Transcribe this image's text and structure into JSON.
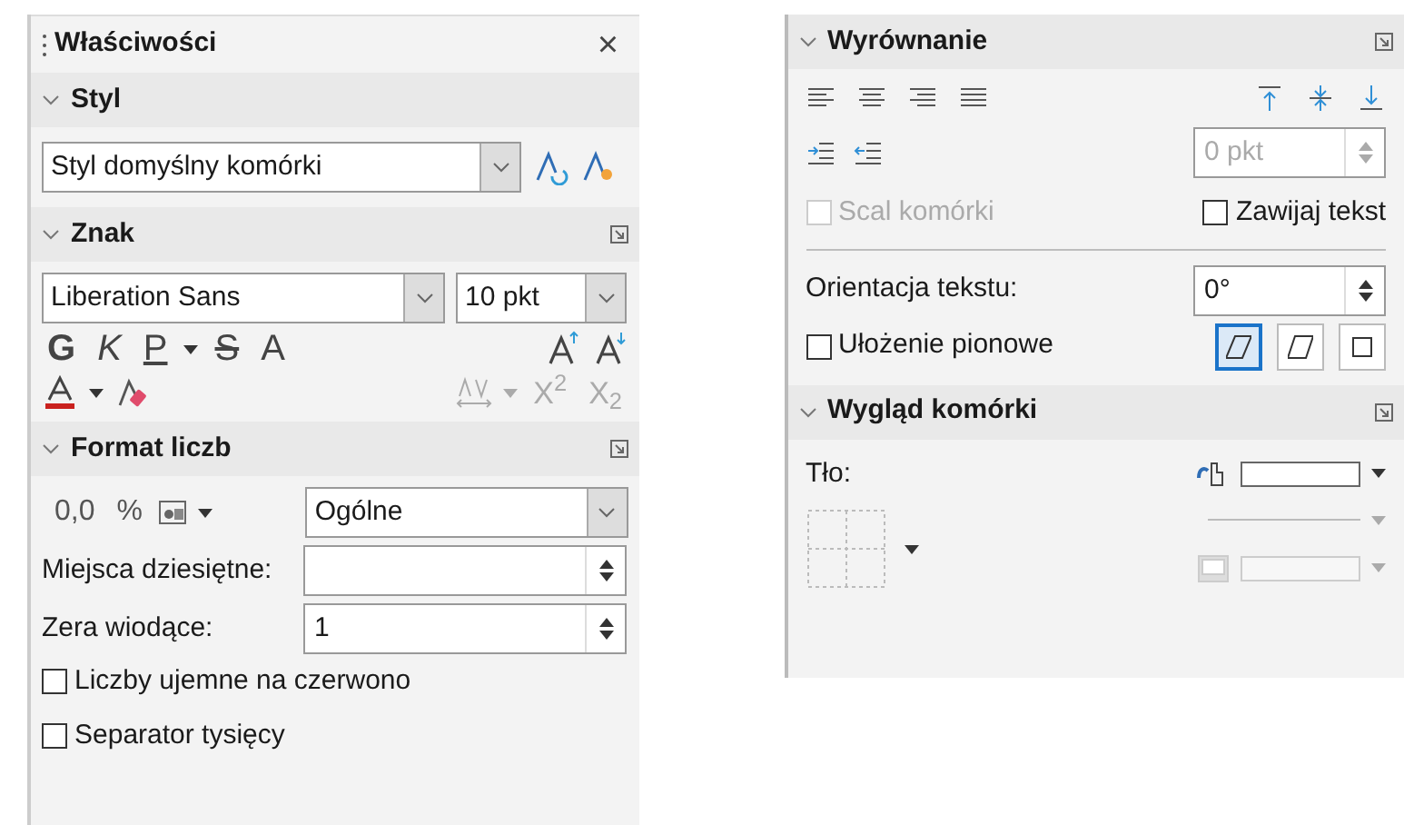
{
  "properties_panel": {
    "title": "Właściwości",
    "close_glyph": "×",
    "style_section": {
      "title": "Styl",
      "expanded": true,
      "style_value": "Styl domyślny komórki"
    },
    "character_section": {
      "title": "Znak",
      "expanded": true,
      "font": "Liberation Sans",
      "size": "10 pkt",
      "format_buttons": [
        {
          "label": "G",
          "kind": "bold",
          "dropdown": false
        },
        {
          "label": "K",
          "kind": "italic",
          "dropdown": false
        },
        {
          "label": "P",
          "kind": "underline",
          "dropdown": true
        },
        {
          "label": "S",
          "kind": "strike",
          "dropdown": false
        },
        {
          "label": "A",
          "kind": "shadow",
          "dropdown": false
        }
      ],
      "spacing_disabled": true,
      "script_buttons": [
        {
          "label": "X$^{2}$",
          "disabled": true
        },
        {
          "label": "X$_{2}$",
          "disabled": true
        }
      ]
    },
    "number_section": {
      "title": "Format liczb",
      "expanded": true,
      "buttons": [
        {
          "label": "0,0"
        },
        {
          "label": "%"
        }
      ],
      "category": "Ogólne",
      "fields": [
        {
          "label": "Miejsca dziesiętne:"
        },
        {
          "label": "Zera wiodące:",
          "value": "1"
        }
      ],
      "checkboxes": [
        {
          "label": "Liczby ujemne na czerwono",
          "checked": false
        },
        {
          "label": "Separator tysięcy",
          "checked": false
        }
      ]
    }
  },
  "alignment_panel": {
    "alignment_section": {
      "title": "Wyrównanie",
      "expanded": true,
      "indent": {
        "value": "0 pkt",
        "disabled": true
      },
      "checkboxes": [
        {
          "label": "Scal komórki",
          "checked": false,
          "disabled": true
        },
        {
          "label": "Zawijaj tekst",
          "checked": false,
          "disabled": false
        }
      ],
      "orientation_label": "Orientacja tekstu:",
      "orientation_value": "0°",
      "stack_checkbox": {
        "label": "Ułożenie pionowe",
        "checked": false
      },
      "orientation_modes": [
        {
          "kind": "slanted",
          "selected": true
        },
        {
          "kind": "italic",
          "selected": false
        },
        {
          "kind": "plain",
          "selected": false
        }
      ]
    },
    "cell_section": {
      "title": "Wygląd komórki",
      "expanded": true,
      "background_label": "Tło:",
      "line_style_disabled": true,
      "shadow_disabled": true
    }
  }
}
